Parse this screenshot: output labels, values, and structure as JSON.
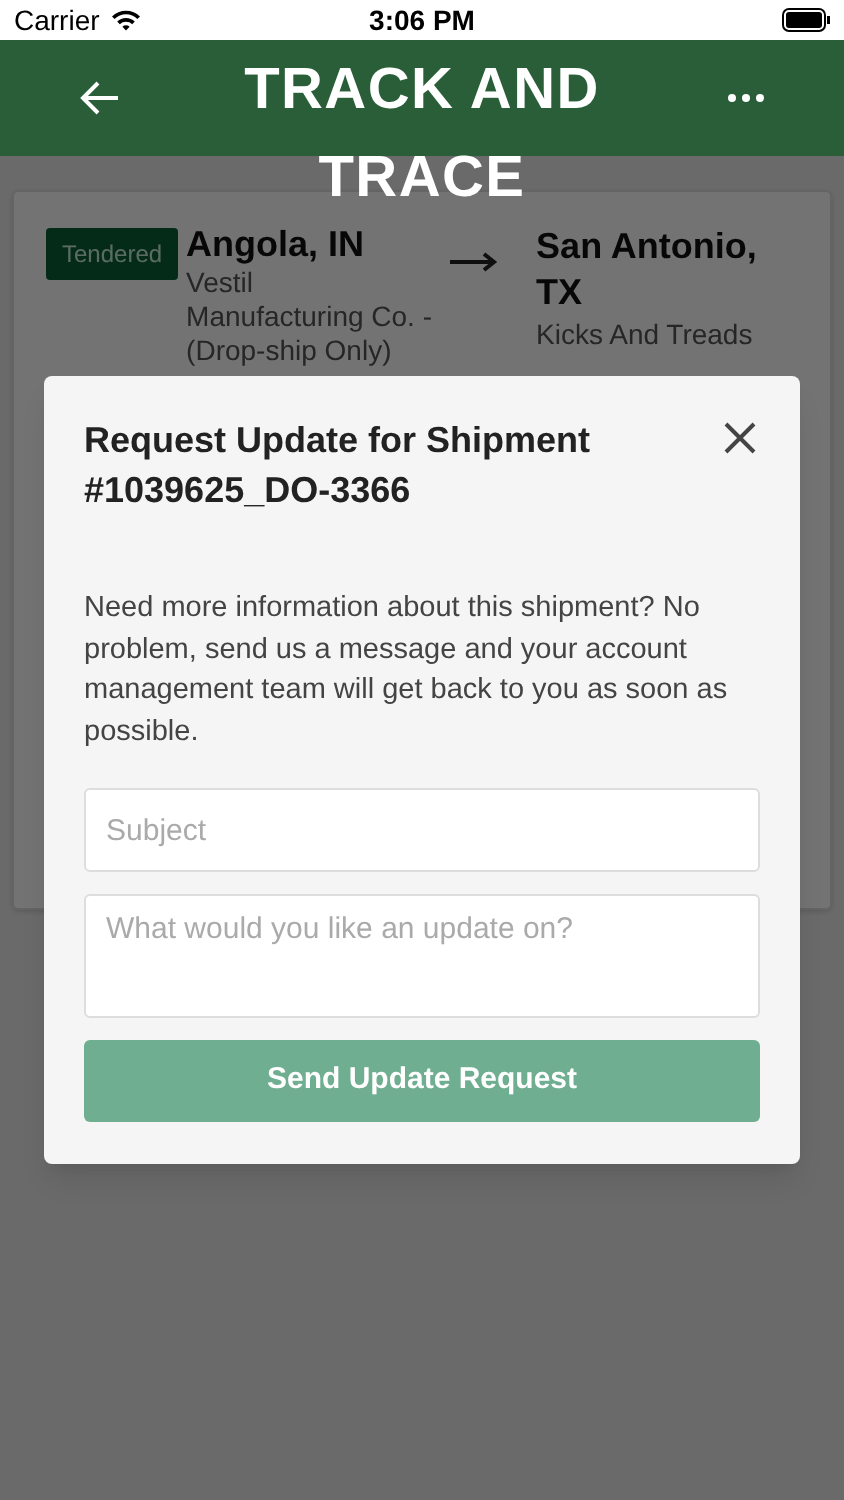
{
  "status_bar": {
    "carrier": "Carrier",
    "time": "3:06 PM"
  },
  "header": {
    "title": "TRACK AND TRACE"
  },
  "shipment": {
    "status_badge": "Tendered",
    "origin": {
      "city": "Angola, IN",
      "company": "Vestil Manufacturing Co. - (Drop-ship Only)"
    },
    "destination": {
      "city": "San Antonio, TX",
      "company": "Kicks And Treads"
    }
  },
  "modal": {
    "title": "Request Update for Shipment #1039625_DO-3366",
    "message": "Need more information about this shipment? No problem, send us a message and your account management team will get back to you as soon as possible.",
    "subject_placeholder": "Subject",
    "details_placeholder": "What would you like an update on?",
    "submit_button": {
      "label": "Send Update Request",
      "disabled": true
    }
  }
}
